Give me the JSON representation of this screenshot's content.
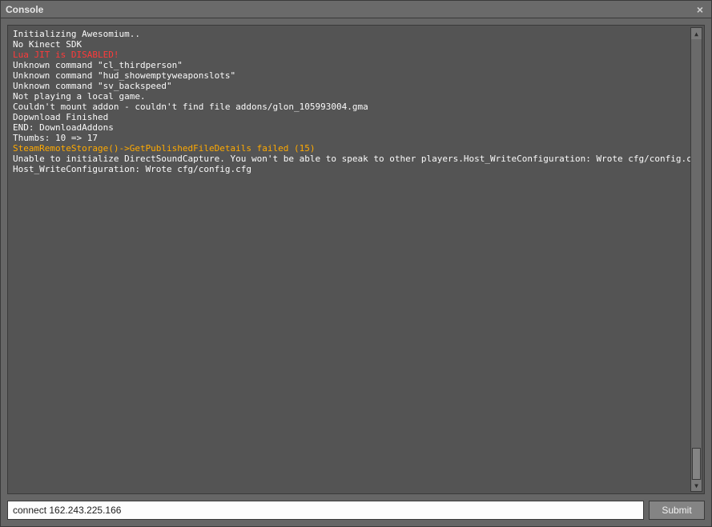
{
  "window": {
    "title": "Console",
    "close_glyph": "×"
  },
  "log": [
    {
      "text": "Initializing Awesomium..",
      "style": "normal"
    },
    {
      "text": "No Kinect SDK",
      "style": "normal"
    },
    {
      "text": "Lua JIT is DISABLED!",
      "style": "error"
    },
    {
      "text": "Unknown command \"cl_thirdperson\"",
      "style": "normal"
    },
    {
      "text": "Unknown command \"hud_showemptyweaponslots\"",
      "style": "normal"
    },
    {
      "text": "Unknown command \"sv_backspeed\"",
      "style": "normal"
    },
    {
      "text": "Not playing a local game.",
      "style": "normal"
    },
    {
      "text": "Couldn't mount addon - couldn't find file addons/glon_105993004.gma",
      "style": "normal"
    },
    {
      "text": "Dopwnload Finished",
      "style": "normal"
    },
    {
      "text": "END: DownloadAddons",
      "style": "normal"
    },
    {
      "text": "Thumbs: 10 => 17",
      "style": "normal"
    },
    {
      "text": "SteamRemoteStorage()->GetPublishedFileDetails failed (15)",
      "style": "warn"
    },
    {
      "text": "Unable to initialize DirectSoundCapture. You won't be able to speak to other players.Host_WriteConfiguration: Wrote cfg/config.cfg",
      "style": "normal"
    },
    {
      "text": "Host_WriteConfiguration: Wrote cfg/config.cfg",
      "style": "normal"
    }
  ],
  "scrollbar": {
    "up_glyph": "▲",
    "down_glyph": "▼"
  },
  "input": {
    "value": "connect 162.243.225.166",
    "placeholder": ""
  },
  "submit_label": "Submit"
}
